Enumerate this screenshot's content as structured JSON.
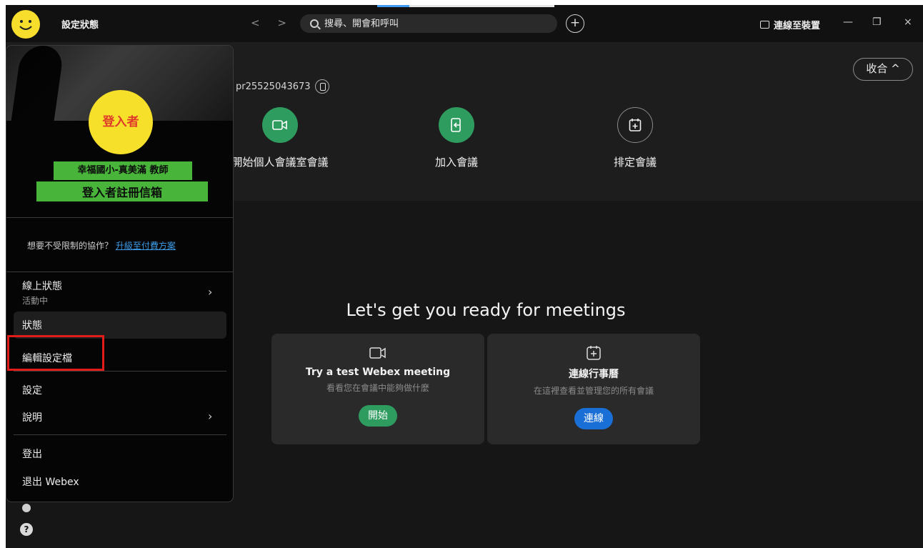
{
  "titlebar": {
    "status_label": "設定狀態",
    "nav_back": "<",
    "nav_forward": ">",
    "search_placeholder": "搜尋、開會和呼叫",
    "plus": "+",
    "connect_device": "連線至裝置",
    "minimize": "—",
    "restore": "❐",
    "close": "×"
  },
  "header": {
    "collapse_label": "收合 ^",
    "sip_address": "pr25525043673"
  },
  "actions": [
    {
      "label": "開始個人會議室會議"
    },
    {
      "label": "加入會議"
    },
    {
      "label": "排定會議"
    }
  ],
  "ready": {
    "title": "Let's get you ready for meetings",
    "cards": [
      {
        "title": "Try a test Webex meeting",
        "subtitle": "看看您在會議中能夠做什麼",
        "button": "開始",
        "button_color": "#2f9c5f"
      },
      {
        "title": "連線行事曆",
        "subtitle": "在這裡查看並管理您的所有會議",
        "button": "連線",
        "button_color": "#1a6fd6"
      }
    ]
  },
  "panel": {
    "avatar_text": "登入者",
    "name": "幸福國小-真美滿 教師",
    "email": "登入者註冊信箱",
    "upgrade_prefix": "想要不受限制的協作？",
    "upgrade_link": "升級至付費方案",
    "online_status_label": "線上狀態",
    "online_status_value": "活動中",
    "status_item": "狀態",
    "edit_profile": "編輯設定檔",
    "settings": "設定",
    "help": "說明",
    "sign_out": "登出",
    "exit": "退出 Webex"
  },
  "colors": {
    "accent_green": "#2f9c5f",
    "link_blue": "#3c9be8",
    "highlight_red": "#e21b1b",
    "avatar_yellow": "#f7e02a",
    "name_tag_green": "#48b53a"
  }
}
